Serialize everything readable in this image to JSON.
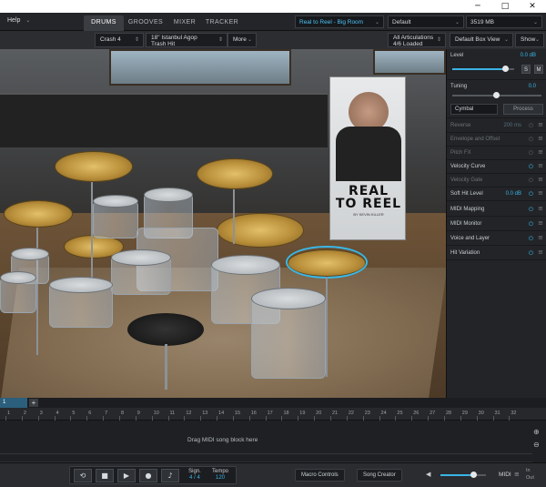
{
  "window": {
    "minimize_glyph": "─",
    "maximize_glyph": "□",
    "close_glyph": "✕"
  },
  "menu": {
    "help": "Help",
    "help_caret": "⌄"
  },
  "tabs": [
    {
      "label": "DRUMS",
      "active": true
    },
    {
      "label": "GROOVES",
      "active": false
    },
    {
      "label": "MIXER",
      "active": false
    },
    {
      "label": "TRACKER",
      "active": false
    }
  ],
  "presets": {
    "kit_preset": "Real to Reel - Big Room",
    "mix_preset": "Default",
    "memory": "3519 MB"
  },
  "toolbar": {
    "instrument": "Crash 4",
    "instrument_model_line1": "18\" Istanbul Agop",
    "instrument_model_line2": "Trash Hit",
    "more": "More",
    "articulations_line1": "All Articulations",
    "articulations_line2": "4/6 Loaded",
    "box_view": "Default Box View",
    "show": "Show"
  },
  "banner": {
    "title_line1": "REAL",
    "title_line2": "TO REEL",
    "subtitle": "BY KEVIN KILLER"
  },
  "panel": {
    "level_label": "Level",
    "level_value": "0.0 dB",
    "solo": "S",
    "mute": "M",
    "tuning_label": "Tuning",
    "tuning_value": "0.0",
    "cymbal_select": "Cymbal",
    "process_button": "Process",
    "rows": [
      {
        "label": "Reverse",
        "value": "200 ms",
        "dim": true
      },
      {
        "label": "Envelope and Offset",
        "value": "",
        "dim": true
      },
      {
        "label": "Pitch FX",
        "value": "",
        "dim": true
      },
      {
        "label": "Velocity Curve",
        "value": "",
        "dim": false
      },
      {
        "label": "Velocity Gate",
        "value": "",
        "dim": true
      },
      {
        "label": "Soft Hit Level",
        "value": "0.0 dB",
        "dim": false
      },
      {
        "label": "MIDI Mapping",
        "value": "",
        "dim": false
      },
      {
        "label": "MIDI Monitor",
        "value": "",
        "dim": false
      },
      {
        "label": "Voice and Layer",
        "value": "",
        "dim": false
      },
      {
        "label": "Hit Variation",
        "value": "",
        "dim": false
      }
    ],
    "power_glyph": "⏻",
    "menu_glyph": "≡"
  },
  "timeline": {
    "track_tab": "1",
    "add_track": "+",
    "ruler_numbers": [
      "1",
      "2",
      "3",
      "4",
      "5",
      "6",
      "7",
      "8",
      "9",
      "10",
      "11",
      "12",
      "13",
      "14",
      "15",
      "16",
      "17",
      "18",
      "19",
      "20",
      "21",
      "22",
      "23",
      "24",
      "25",
      "26",
      "27",
      "28",
      "29",
      "30",
      "31",
      "32"
    ],
    "drag_hint": "Drag MIDI song block here",
    "zoom_in": "⊕",
    "zoom_out": "⊖"
  },
  "transport": {
    "loop": "⟲",
    "stop": "■",
    "play": "▶",
    "record": "●",
    "metronome": "♪",
    "sign_label": "Sign.",
    "sign_value": "4 / 4",
    "tempo_label": "Tempo",
    "tempo_value": "120",
    "macro_controls": "Macro Controls",
    "song_creator": "Song Creator",
    "speaker": "◀",
    "midi": "MIDI",
    "midi_menu": "≡",
    "in_label": "In",
    "out_label": "Out"
  },
  "colors": {
    "accent": "#3ab4e6",
    "selection_ring": "#39b8e8"
  }
}
